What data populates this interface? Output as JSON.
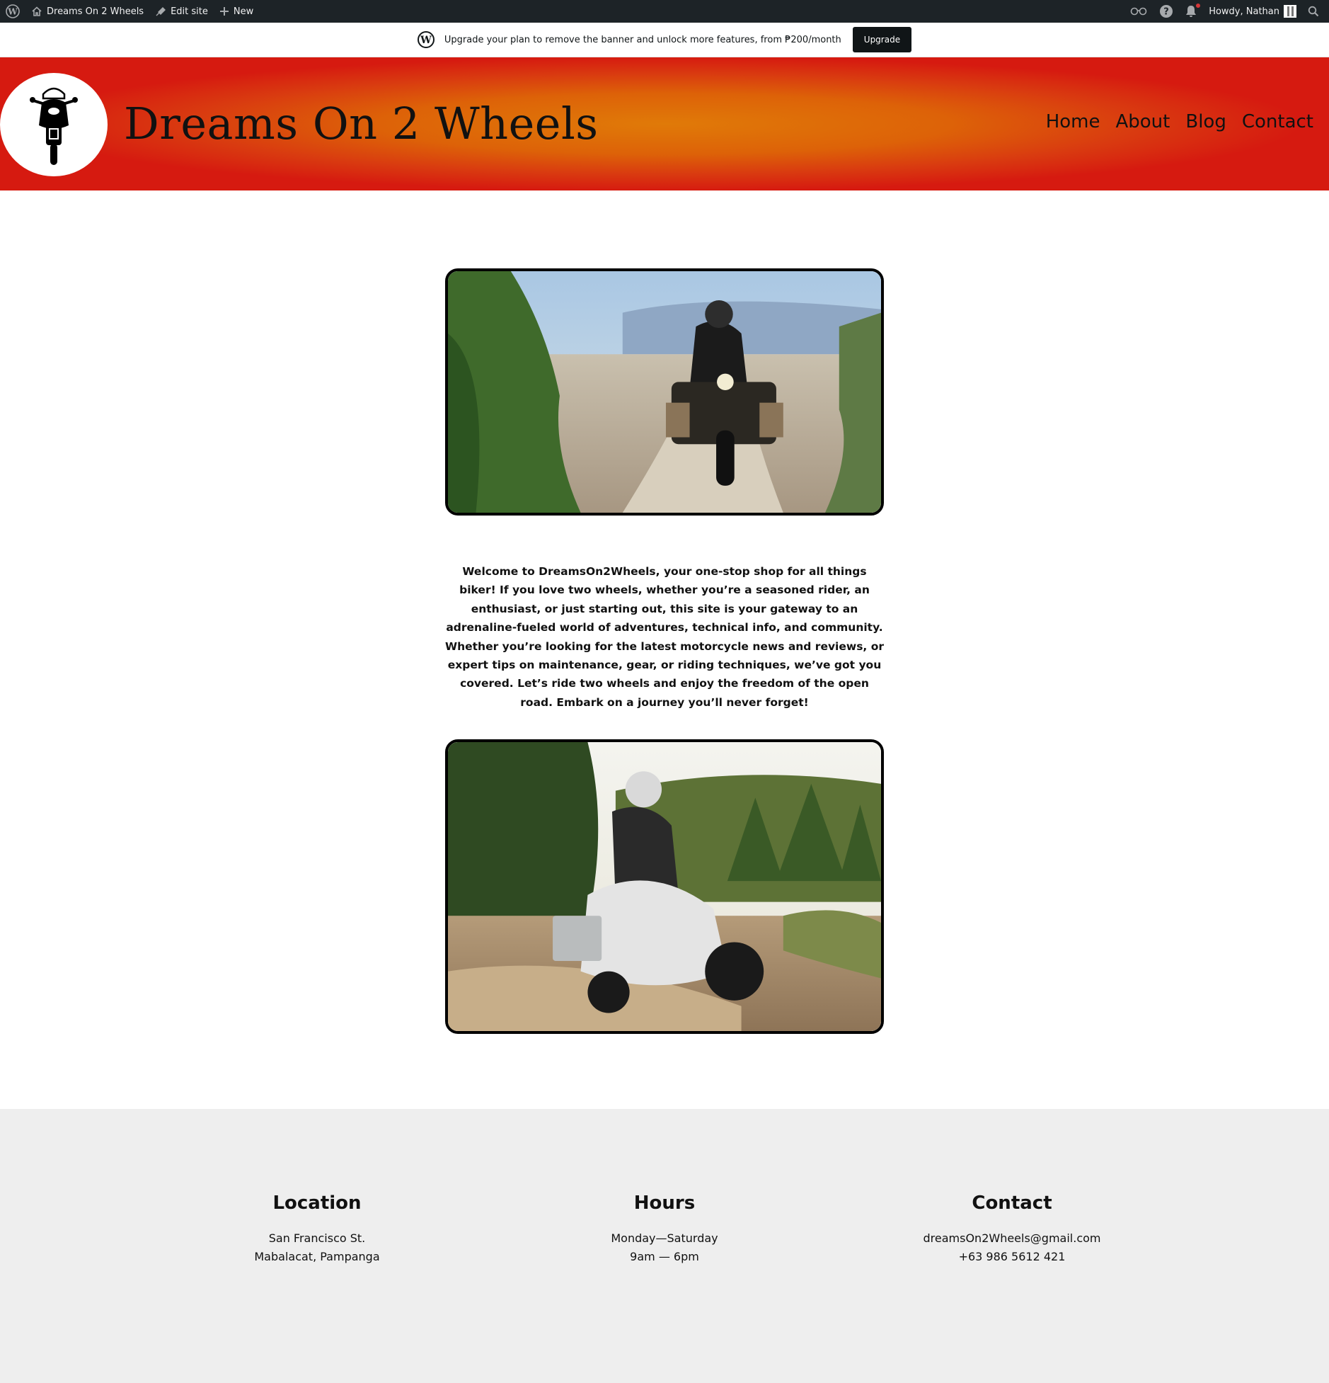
{
  "admin_bar": {
    "site_name": "Dreams On 2 Wheels",
    "edit_site": "Edit site",
    "new": "New",
    "howdy": "Howdy, Nathan"
  },
  "banner": {
    "text": "Upgrade your plan to remove the banner and unlock more features, from ₱200/month",
    "button": "Upgrade"
  },
  "header": {
    "title": "Dreams On 2 Wheels",
    "nav": [
      "Home",
      "About",
      "Blog",
      "Contact"
    ],
    "gradient_colors": [
      "#e07a08",
      "#d61a10"
    ]
  },
  "main": {
    "intro": "Welcome to DreamsOn2Wheels, your one-stop shop for all things biker! If you love two wheels, whether you’re a seasoned rider, an enthusiast, or just starting out, this site is your gateway to an adrenaline-fueled world of adventures, technical info, and community. Whether you’re looking for the latest motorcycle news and reviews, or expert tips on maintenance, gear, or riding techniques, we’ve got you covered. Let’s ride two wheels and enjoy the freedom of the open road. Embark on a journey you’ll never forget!"
  },
  "footer": {
    "location": {
      "heading": "Location",
      "line1": "San Francisco St.",
      "line2": "Mabalacat, Pampanga"
    },
    "hours": {
      "heading": "Hours",
      "line1": "Monday—Saturday",
      "line2": "9am — 6pm"
    },
    "contact": {
      "heading": "Contact",
      "line1": "dreamsOn2Wheels@gmail.com",
      "line2": "+63 986 5612 421"
    }
  }
}
